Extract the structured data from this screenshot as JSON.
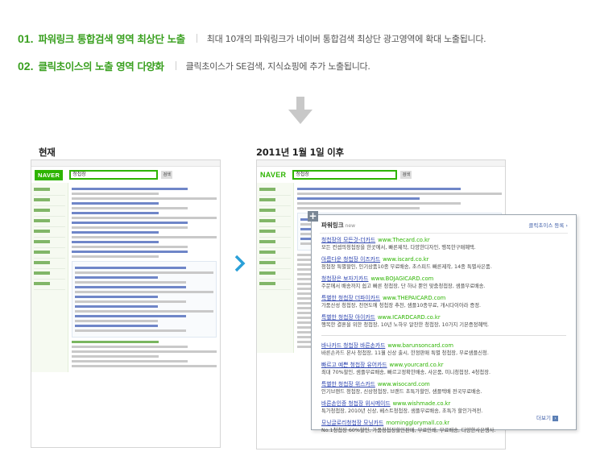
{
  "points": [
    {
      "number": "01.",
      "title": "파워링크 통합검색 영역 최상단 노출",
      "desc": "최대 10개의 파워링크가 네이버 통합검색 최상단 광고영역에 확대 노출됩니다."
    },
    {
      "number": "02.",
      "title": "클릭초이스의 노출 영역 다양화",
      "desc": "클릭초이스가 SE검색, 지식쇼핑에 추가 노출됩니다."
    }
  ],
  "captions": {
    "current": "현재",
    "after": "2011년 1월 1일 이후"
  },
  "shot_current": {
    "logo": "NAVER",
    "query": "청첩장",
    "button": "검색"
  },
  "shot_after": {
    "logo": "NAVER",
    "query": "청첩장",
    "button": "검색"
  },
  "popup": {
    "title": "파워링크",
    "beta": "new",
    "right_link": "클릭초이스 등록 ›",
    "more": "더보기",
    "group1": [
      {
        "title": "청첩장의 모든것-더카드",
        "url": "www.Thecard.co.kr",
        "desc": "모든 컨셉의청첩장을 한곳에서, 빠른제작, 다양한디자인, 행복한구매혜택."
      },
      {
        "title": "아름다운 청첩장 이즈카드",
        "url": "www.iscard.co.kr",
        "desc": "청첩장 특별할인, 인기상품10종 무료배송, 초스피드 빠른제작, 14종 특별사은품."
      },
      {
        "title": "청첩장은 보자기카드",
        "url": "www.BOJAGICARD.com",
        "desc": "주문에서 배송까지 쉽고 빠른 청첩장, 단 하나 뿐인 맞춤청첩장, 샘플무료배송."
      },
      {
        "title": "특별한 청첩장 더파이카드",
        "url": "www.THEPAICARD.com",
        "desc": "가품산성 청첩장, 천연도에 청첩장 추천, 샘플10종무료, 개시다이아라 증정."
      },
      {
        "title": "특별한 청첩장 아이카드",
        "url": "www.ICARDCARD.co.kr",
        "desc": "행복한 결혼을 위한 청첩장, 10년 노하우 알찬한 청첩장, 10가지 기본증정혜택."
      }
    ],
    "group2": [
      {
        "title": "바나카드 청첩장 바른손카드",
        "url": "www.barunsoncard.com",
        "desc": "바른손카드 본사 청첩장, 11월 신상 출시, 한정판매 특별 청첩장, 무료샘플신청."
      },
      {
        "title": "빠르고 예쁜 청첩장 유어카드",
        "url": "www.yourcard.co.kr",
        "desc": "최대 70%할인, 샘플무료배송, 빠르고정확한배송, 사은품, 미니청첩장, 4청첩장."
      },
      {
        "title": "특별한 청첩장 위스카드",
        "url": "www.wisocard.com",
        "desc": "인기브랜드 청첩장, 신상청첩장, 브랜드 초특가할인, 샘플택배 전국무료배송."
      },
      {
        "title": "바른손인증 청첩장 위시메이드",
        "url": "www.wishmade.co.kr",
        "desc": "특가청첩장, 2010년 신상, 베스트청첩장, 샘플무료배송, 초특가 할인가격전."
      },
      {
        "title": "모닝글로리청첩장 모닝카드",
        "url": "morningglorymall.co.kr",
        "desc": "No.1청첩장 60%할인, 가품청첩장할인판매, 무료인쇄, 무료배송, 다양한사은행사."
      }
    ]
  },
  "colors": {
    "accent_green": "#3aa020",
    "naver_green": "#2db400",
    "link_blue": "#2e45b0",
    "arrow_blue": "#2aa0d8",
    "arrow_gray": "#c8c8c8"
  },
  "icons": [
    "down-arrow-icon",
    "right-chevron-icon",
    "plus-icon",
    "more-icon"
  ]
}
